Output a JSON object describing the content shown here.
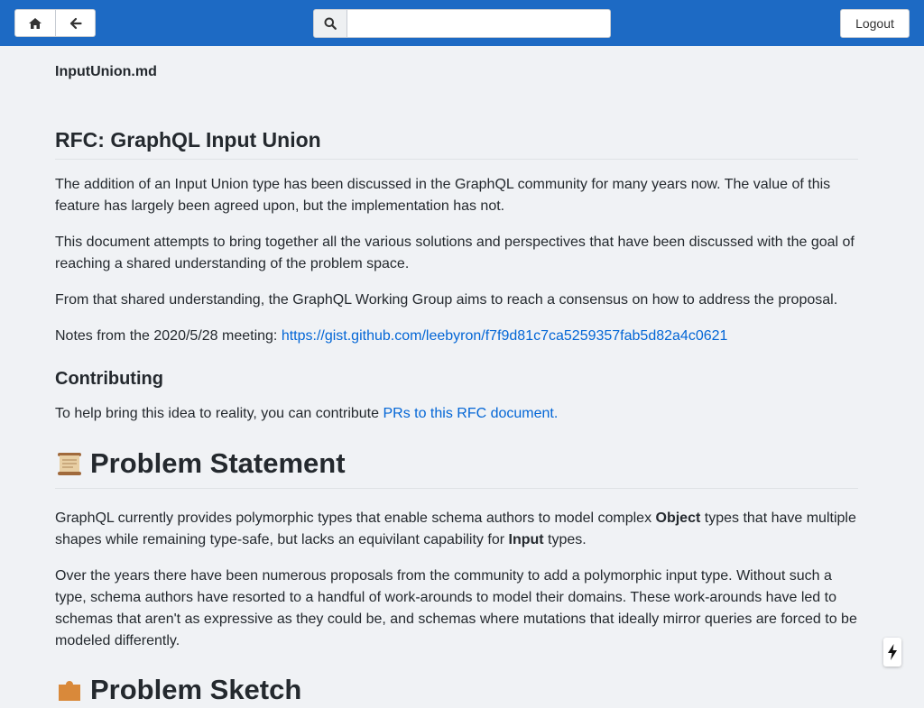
{
  "colors": {
    "topbar": "#1d6ac4",
    "link": "#0366d6",
    "background": "#f0f2f5"
  },
  "topbar": {
    "home_icon": "home-icon",
    "back_icon": "arrow-left-icon",
    "search_icon": "search-icon",
    "search_value": "",
    "logout_label": "Logout"
  },
  "document": {
    "filename": "InputUnion.md",
    "title": "RFC: GraphQL Input Union",
    "intro": {
      "p1": "The addition of an Input Union type has been discussed in the GraphQL community for many years now. The value of this feature has largely been agreed upon, but the implementation has not.",
      "p2": "This document attempts to bring together all the various solutions and perspectives that have been discussed with the goal of reaching a shared understanding of the problem space.",
      "p3": "From that shared understanding, the GraphQL Working Group aims to reach a consensus on how to address the proposal.",
      "p4_prefix": "Notes from the 2020/5/28 meeting: ",
      "p4_link": "https://gist.github.com/leebyron/f7f9d81c7ca5259357fab5d82a4c0621"
    },
    "contributing": {
      "heading": "Contributing",
      "text_prefix": "To help bring this idea to reality, you can contribute ",
      "link": "PRs to this RFC document."
    },
    "problem": {
      "icon": "scroll-icon",
      "heading": "Problem Statement",
      "p1_a": "GraphQL currently provides polymorphic types that enable schema authors to model complex ",
      "p1_b": "Object",
      "p1_c": " types that have multiple shapes while remaining type-safe, but lacks an equivilant capability for ",
      "p1_d": "Input",
      "p1_e": " types.",
      "p2": "Over the years there have been numerous proposals from the community to add a polymorphic input type. Without such a type, schema authors have resorted to a handful of work-arounds to model their domains. These work-arounds have led to schemas that aren't as expressive as they could be, and schemas where mutations that ideally mirror queries are forced to be modeled differently."
    },
    "next_section": {
      "icon": "puzzle-icon",
      "heading": "Problem Sketch"
    }
  },
  "floating_badge_icon": "bolt-icon"
}
